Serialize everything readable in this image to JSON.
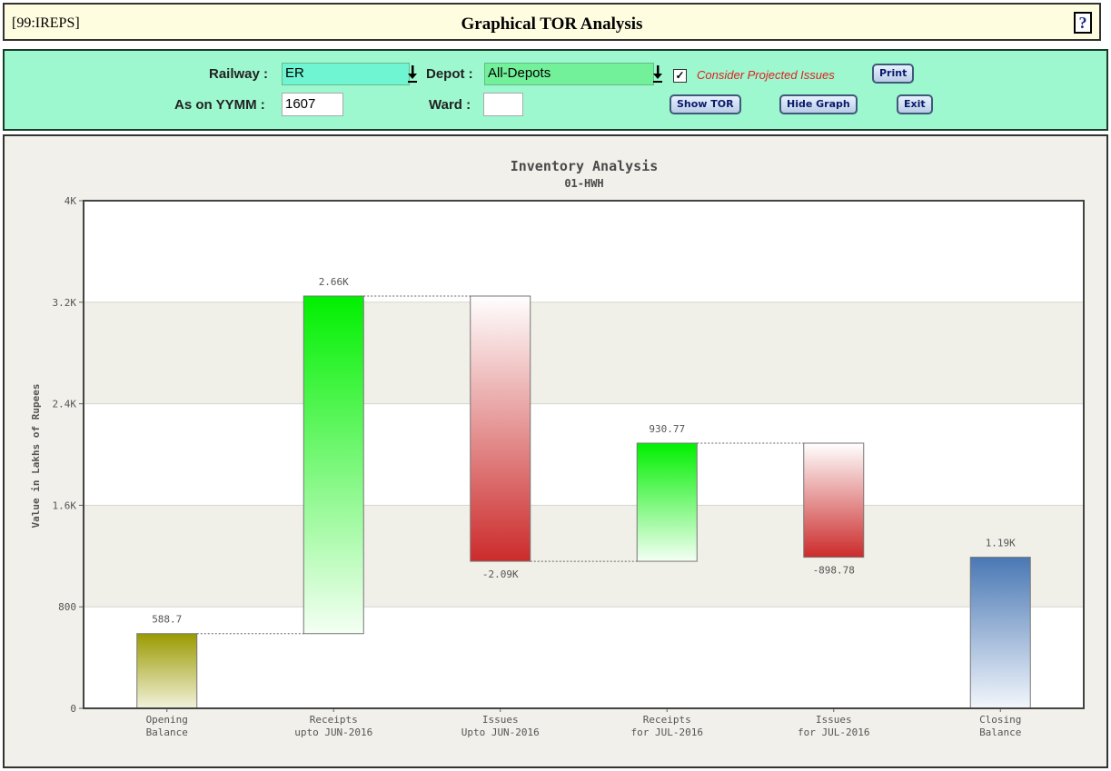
{
  "window": {
    "code": "[99:IREPS]",
    "title": "Graphical TOR Analysis",
    "help_glyph": "?"
  },
  "form": {
    "railway_label": "Railway :",
    "railway_value": "ER",
    "depot_label": "Depot :",
    "depot_value": "All-Depots",
    "consider_label": "Consider Projected Issues",
    "consider_checked": true,
    "yymm_label": "As on YYMM :",
    "yymm_value": "1607",
    "ward_label": "Ward :",
    "ward_value": "",
    "buttons": {
      "print": "Print",
      "show_tor": "Show TOR",
      "hide_graph": "Hide Graph",
      "exit": "Exit"
    }
  },
  "chart_data": {
    "type": "bar",
    "subtype": "waterfall",
    "title": "Inventory Analysis",
    "subtitle": "01-HWH",
    "ylabel": "Value in Lakhs of Rupees",
    "xlabel": "",
    "ylim": [
      0,
      4000
    ],
    "yticks": [
      0,
      800,
      1600,
      2400,
      3200,
      4000
    ],
    "ytick_labels": [
      "0",
      "800",
      "1.6K",
      "2.4K",
      "3.2K",
      "4K"
    ],
    "categories": [
      [
        "Opening",
        "Balance"
      ],
      [
        "Receipts",
        "upto JUN-2016"
      ],
      [
        "Issues",
        "Upto JUN-2016"
      ],
      [
        "Receipts",
        "for JUL-2016"
      ],
      [
        "Issues",
        "for JUL-2016"
      ],
      [
        "Closing",
        "Balance"
      ]
    ],
    "bars": [
      {
        "start": 0,
        "end": 588.7,
        "label": "588.7",
        "kind": "total"
      },
      {
        "start": 588.7,
        "end": 3248.7,
        "label": "2.66K",
        "kind": "increase"
      },
      {
        "start": 3248.7,
        "end": 1158.7,
        "label": "-2.09K",
        "kind": "decrease"
      },
      {
        "start": 1158.7,
        "end": 2089.5,
        "label": "930.77",
        "kind": "increase"
      },
      {
        "start": 2089.5,
        "end": 1190.7,
        "label": "-898.78",
        "kind": "decrease"
      },
      {
        "start": 0,
        "end": 1190.7,
        "label": "1.19K",
        "kind": "total"
      }
    ],
    "grid": true,
    "legend": "none",
    "colors": {
      "increase_top": "#00f000",
      "increase_bottom": "#f4fff4",
      "decrease_top": "#ffffff",
      "decrease_bottom": "#cc2b2b",
      "opening_top": "#9a9a00",
      "opening_bottom": "#f2f2dc",
      "closing_top": "#4a78b4",
      "closing_bottom": "#f2f6fc",
      "band": "#f0efe8",
      "label_text": "#555555"
    }
  }
}
